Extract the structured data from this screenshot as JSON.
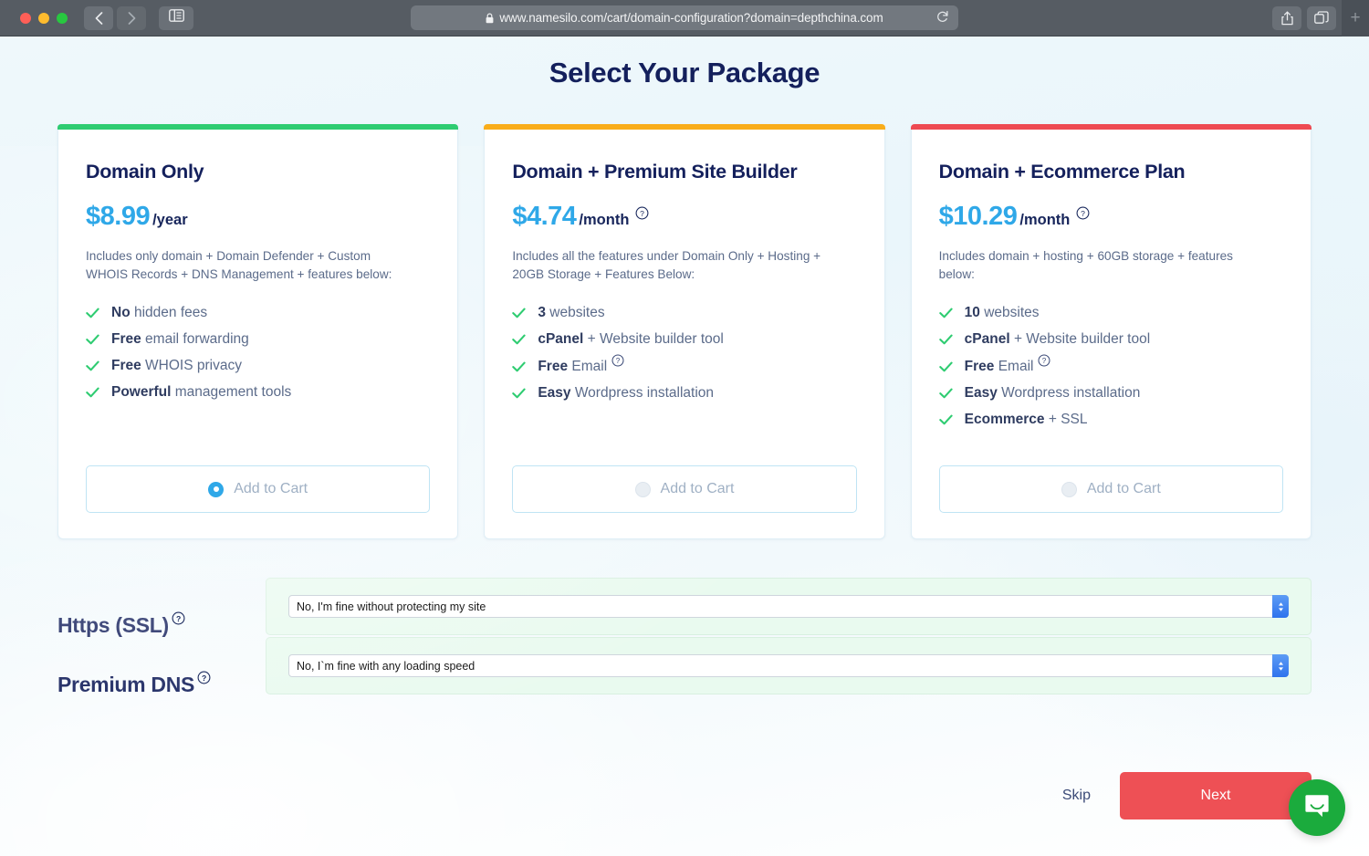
{
  "browser": {
    "url": "www.namesilo.com/cart/domain-configuration?domain=depthchina.com",
    "back_icon": "back-chevron-icon",
    "forward_icon": "forward-chevron-icon",
    "sidebar_icon": "sidebar-toggle-icon",
    "lock_icon": "lock-icon",
    "reload_icon": "reload-icon",
    "share_icon": "share-icon",
    "tabs_icon": "tab-overview-icon",
    "new_tab_label": "+"
  },
  "page": {
    "title": "Select Your Package"
  },
  "colors": {
    "accent_green": "#2ecc71",
    "accent_amber": "#f9ad1a",
    "accent_red": "#ee4a52",
    "price_blue": "#2fa8e8",
    "title_navy": "#14205c",
    "next_red": "#ee5055",
    "chat_green": "#1bab3d"
  },
  "packages": [
    {
      "accent": "#2ecc71",
      "title": "Domain Only",
      "price": "$8.99",
      "period": "/year",
      "has_price_help": false,
      "description": "Includes only domain + Domain Defender + Custom WHOIS Records + DNS Management + features below:",
      "features": [
        {
          "strong": "No",
          "rest": " hidden fees",
          "help": false
        },
        {
          "strong": "Free",
          "rest": " email forwarding",
          "help": false
        },
        {
          "strong": "Free",
          "rest": " WHOIS privacy",
          "help": false
        },
        {
          "strong": "Powerful",
          "rest": " management tools",
          "help": false
        }
      ],
      "cart_label": "Add to Cart",
      "selected": true
    },
    {
      "accent": "#f9ad1a",
      "title": "Domain + Premium Site Builder",
      "price": "$4.74",
      "period": "/month",
      "has_price_help": true,
      "description": "Includes all the features under Domain Only + Hosting + 20GB Storage + Features Below:",
      "features": [
        {
          "strong": "3",
          "rest": " websites",
          "help": false
        },
        {
          "strong": "cPanel",
          "rest": " + Website builder tool",
          "help": false
        },
        {
          "strong": "Free",
          "rest": " Email",
          "help": true
        },
        {
          "strong": "Easy",
          "rest": " Wordpress installation",
          "help": false
        }
      ],
      "cart_label": "Add to Cart",
      "selected": false
    },
    {
      "accent": "#ee4a52",
      "title": "Domain + Ecommerce Plan",
      "price": "$10.29",
      "period": "/month",
      "has_price_help": true,
      "description": "Includes domain + hosting + 60GB storage + features below:",
      "features": [
        {
          "strong": "10",
          "rest": " websites",
          "help": false
        },
        {
          "strong": "cPanel",
          "rest": " + Website builder tool",
          "help": false
        },
        {
          "strong": "Free",
          "rest": " Email",
          "help": true
        },
        {
          "strong": "Easy",
          "rest": "  Wordpress installation",
          "help": false
        },
        {
          "strong": "Ecommerce",
          "rest": " + SSL",
          "help": false
        }
      ],
      "cart_label": "Add to Cart",
      "selected": false
    }
  ],
  "options": [
    {
      "label": "Https (SSL)",
      "value": "No, I'm fine without protecting my site"
    },
    {
      "label": "Premium DNS",
      "value": "No, I`m fine with any loading speed"
    }
  ],
  "footer": {
    "skip_label": "Skip",
    "next_label": "Next"
  },
  "chat": {
    "icon": "chat-bubble-icon"
  }
}
